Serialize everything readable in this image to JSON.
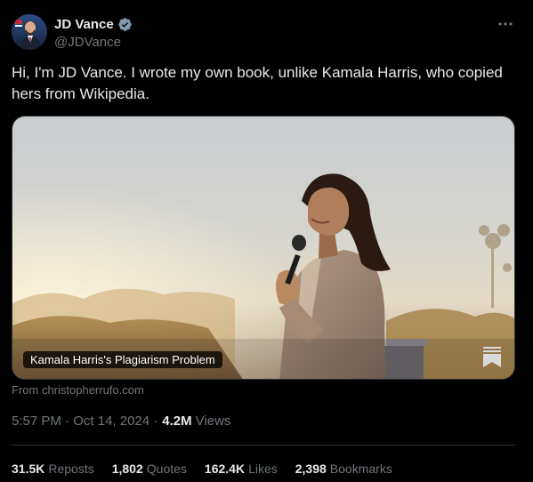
{
  "author": {
    "display_name": "JD Vance",
    "handle": "@JDVance"
  },
  "tweet": {
    "text": "Hi, I'm JD Vance. I wrote my own book, unlike Kamala Harris, who copied hers from Wikipedia."
  },
  "card": {
    "title": "Kamala Harris's Plagiarism Problem",
    "source": "From christopherrufo.com"
  },
  "meta": {
    "time": "5:57 PM",
    "date": "Oct 14, 2024",
    "views_count": "4.2M",
    "views_label": "Views"
  },
  "stats": [
    {
      "count": "31.5K",
      "label": "Reposts"
    },
    {
      "count": "1,802",
      "label": "Quotes"
    },
    {
      "count": "162.4K",
      "label": "Likes"
    },
    {
      "count": "2,398",
      "label": "Bookmarks"
    }
  ],
  "icons": {
    "verified": "verified-badge-icon",
    "more": "more-dots-icon",
    "bookmark": "bookmark-stack-icon"
  },
  "colors": {
    "background": "#000000",
    "text_primary": "#e7e9ea",
    "text_secondary": "#71767b",
    "divider": "#2f3336",
    "verified_badge": "#829aab"
  }
}
